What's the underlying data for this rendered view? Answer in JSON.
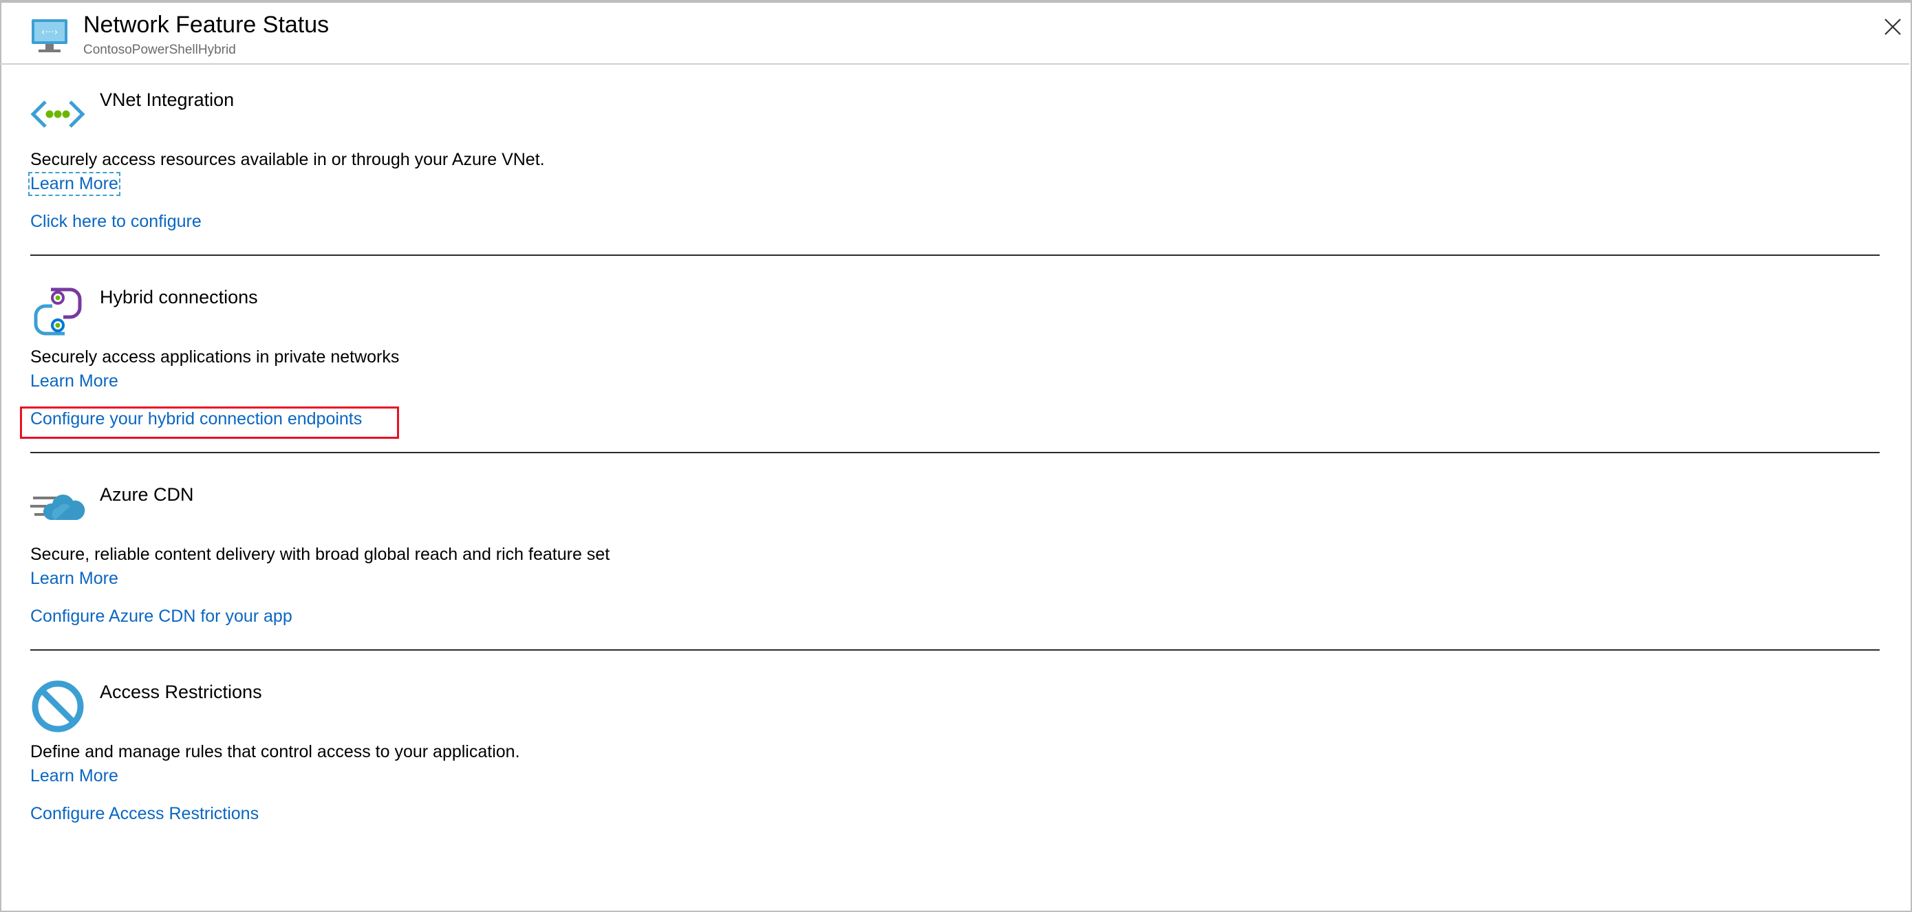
{
  "header": {
    "title": "Network Feature Status",
    "subtitle": "ContosoPowerShellHybrid",
    "icon": "app-service-network-icon",
    "close_icon": "close-icon"
  },
  "sections": [
    {
      "title": "VNet Integration",
      "icon": "vnet-integration-icon",
      "description": "Securely access resources available in or through your Azure VNet.",
      "learn_more": "Learn More",
      "action": "Click here to configure"
    },
    {
      "title": "Hybrid connections",
      "icon": "hybrid-connections-icon",
      "description": "Securely access applications in private networks",
      "learn_more": "Learn More",
      "action": "Configure your hybrid connection endpoints",
      "highlighted": true
    },
    {
      "title": "Azure CDN",
      "icon": "azure-cdn-icon",
      "description": "Secure, reliable content delivery with broad global reach and rich feature set",
      "learn_more": "Learn More",
      "action": "Configure Azure CDN for your app"
    },
    {
      "title": "Access Restrictions",
      "icon": "access-restrictions-icon",
      "description": "Define and manage rules that control access to your application.",
      "learn_more": "Learn More",
      "action": "Configure Access Restrictions"
    }
  ],
  "colors": {
    "link": "#0a66c2",
    "highlight_border": "#e81123",
    "divider": "#2b2b2b",
    "vnet_blue": "#3c9fd3",
    "vnet_green": "#6bb700",
    "hybrid_purple": "#773aa0",
    "cdn_blue": "#3999c6",
    "restriction_blue": "#3c9fd3"
  }
}
